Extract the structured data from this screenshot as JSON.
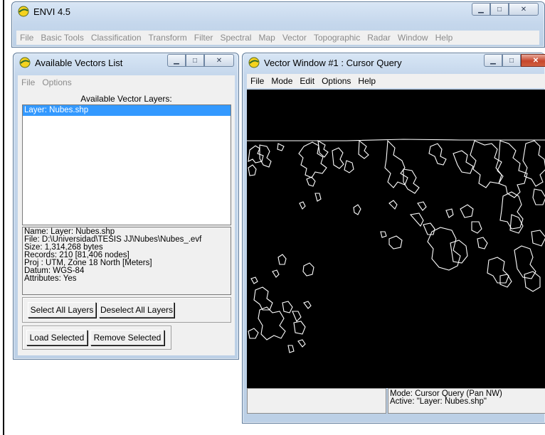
{
  "main_window": {
    "title": "ENVI 4.5",
    "menu": [
      "File",
      "Basic Tools",
      "Classification",
      "Transform",
      "Filter",
      "Spectral",
      "Map",
      "Vector",
      "Topographic",
      "Radar",
      "Window",
      "Help"
    ]
  },
  "vectors_list_window": {
    "title": "Available Vectors List",
    "menu": [
      "File",
      "Options"
    ],
    "list_header": "Available Vector Layers:",
    "layers": [
      "Layer: Nubes.shp"
    ],
    "info": [
      "Name: Layer: Nubes.shp",
      "File: D:\\Universidad\\TESIS JJ\\Nubes\\Nubes_.evf",
      "Size: 1,314,268 bytes",
      "Records: 210 [81,406 nodes]",
      "Proj : UTM, Zone 18 North [Meters]",
      "Datum: WGS-84",
      "Attributes: Yes"
    ],
    "select_all_label": "Select All Layers",
    "deselect_all_label": "Deselect All Layers",
    "load_selected_label": "Load Selected",
    "remove_selected_label": "Remove Selected"
  },
  "vector_window": {
    "title": "Vector Window #1 : Cursor Query",
    "menu": [
      "File",
      "Mode",
      "Edit",
      "Options",
      "Help"
    ],
    "status_mode": "Mode: Cursor Query (Pan NW)",
    "status_active": "Active: \"Layer: Nubes.shp\""
  },
  "colors": {
    "selection": "#3399ff",
    "canvas_background": "#000000",
    "vector_lines": "#ffffff"
  }
}
